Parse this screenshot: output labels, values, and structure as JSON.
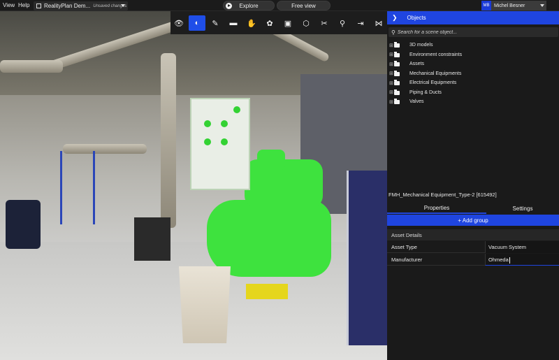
{
  "topbar": {
    "menu": [
      "View",
      "Help"
    ],
    "project_name": "RealityPlan Dem...",
    "project_status": "Unsaved changes",
    "modes": {
      "explore": "Explore",
      "free_view": "Free view"
    },
    "user": {
      "initials": "MB",
      "name": "Michel Besner"
    }
  },
  "toolbar": {
    "tools": [
      {
        "icon": "eye-icon",
        "glyph": "👁"
      },
      {
        "icon": "contrast-icon",
        "glyph": "◐",
        "active": true
      },
      {
        "icon": "measure-icon",
        "glyph": "✎"
      },
      {
        "icon": "comment-icon",
        "glyph": "▬"
      },
      {
        "icon": "hand-icon",
        "glyph": "✋"
      },
      {
        "icon": "palette-icon",
        "glyph": "✿"
      },
      {
        "icon": "crop-icon",
        "glyph": "▣"
      },
      {
        "icon": "cube-icon",
        "glyph": "⬡"
      },
      {
        "icon": "scissors-icon",
        "glyph": "✂"
      },
      {
        "icon": "link-icon",
        "glyph": "⚲"
      },
      {
        "icon": "export-icon",
        "glyph": "⇥"
      },
      {
        "icon": "share-icon",
        "glyph": "⋈"
      }
    ]
  },
  "objects_panel": {
    "title": "Objects",
    "search_placeholder": "Search for a scene object...",
    "tree": [
      "3D models",
      "Environment constraints",
      "Assets",
      "Mechanical Equipments",
      "Electrical Equipments",
      "Piping & Ducts",
      "Valves"
    ]
  },
  "selection": {
    "name": "FMH_Mechanical Equipment_Type-2 [615492]",
    "tabs": {
      "properties": "Properties",
      "settings": "Settings"
    },
    "add_group": "+ Add group",
    "section": "Asset Details",
    "properties": [
      {
        "key": "Asset Type",
        "value": "Vacuum System"
      },
      {
        "key": "Manufacturer",
        "value": "Ohmeda"
      }
    ]
  },
  "colors": {
    "accent": "#1f45e0",
    "highlight": "#3ee23e"
  }
}
